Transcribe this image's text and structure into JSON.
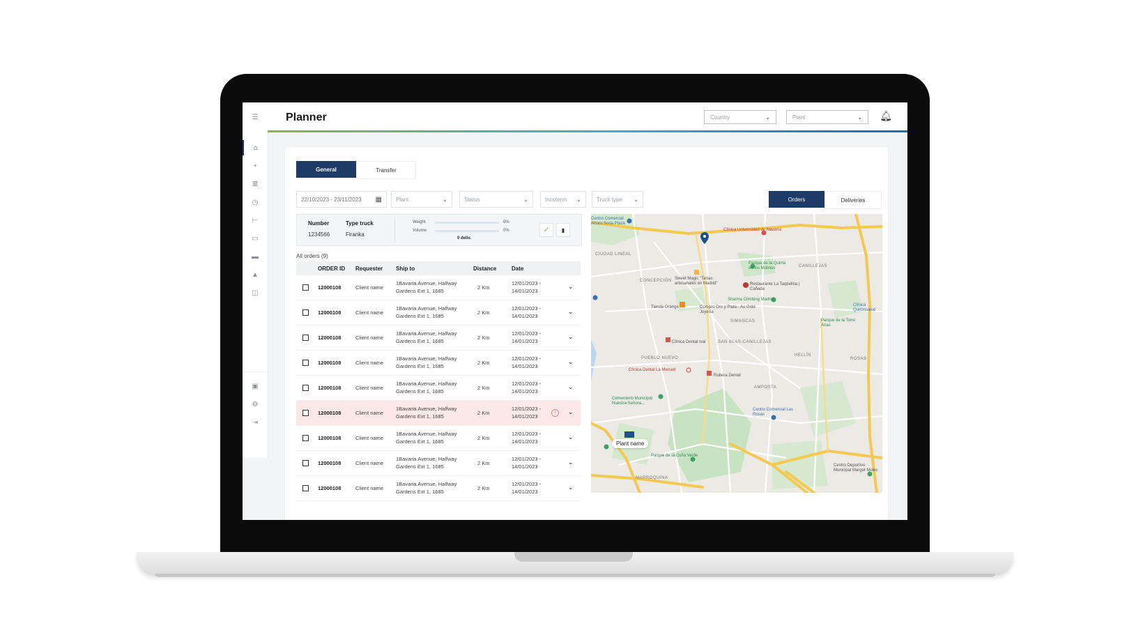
{
  "app": {
    "title": "Planner"
  },
  "header": {
    "country_placeholder": "Country",
    "plant_placeholder": "Plant"
  },
  "tabs": {
    "general": "General",
    "transfer": "Transfer"
  },
  "filters": {
    "date_range": "22/10/2023 - 23/11/2023",
    "plant": "Plant",
    "status": "Status",
    "incoterm": "Incoterm",
    "truck_type": "Truck type"
  },
  "view_toggle": {
    "orders": "Orders",
    "deliveries": "Deliveries"
  },
  "truck": {
    "number_label": "Number",
    "number_value": "1234566",
    "type_label": "Type truck",
    "type_value": "Firanka",
    "weight_label": "Weight",
    "weight_pct": "0%",
    "volume_label": "Volume",
    "volume_pct": "0%",
    "deliveries": "0 deliv."
  },
  "orders_title": "All orders (9)",
  "table": {
    "headers": {
      "order_id": "ORDER ID",
      "requester": "Requester",
      "ship_to": "Ship to",
      "distance": "Distance",
      "date": "Date"
    },
    "rows": [
      {
        "order_id": "12000108",
        "requester": "Client name",
        "ship_to": "1Bavaria Avenue, Halfway Gardens Ext 1, 1685",
        "distance": "2 Km",
        "date": "12/01/2023 - 14/01/2023",
        "alert": false
      },
      {
        "order_id": "12000108",
        "requester": "Client name",
        "ship_to": "1Bavaria Avenue, Halfway Gardens Ext 1, 1685",
        "distance": "2 Km",
        "date": "12/01/2023 - 14/01/2023",
        "alert": false
      },
      {
        "order_id": "12000108",
        "requester": "Client name",
        "ship_to": "1Bavaria Avenue, Halfway Gardens Ext 1, 1685",
        "distance": "2 Km",
        "date": "12/01/2023 - 14/01/2023",
        "alert": false
      },
      {
        "order_id": "12000108",
        "requester": "Client name",
        "ship_to": "1Bavaria Avenue, Halfway Gardens Ext 1, 1685",
        "distance": "2 Km",
        "date": "12/01/2023 - 14/01/2023",
        "alert": false
      },
      {
        "order_id": "12000108",
        "requester": "Client name",
        "ship_to": "1Bavaria Avenue, Halfway Gardens Ext 1, 1685",
        "distance": "2 Km",
        "date": "12/01/2023 - 14/01/2023",
        "alert": false
      },
      {
        "order_id": "12000108",
        "requester": "Client name",
        "ship_to": "1Bavaria Avenue, Halfway Gardens Ext 1, 1685",
        "distance": "2 Km",
        "date": "12/01/2023 - 14/01/2023",
        "alert": true
      },
      {
        "order_id": "12000108",
        "requester": "Client name",
        "ship_to": "1Bavaria Avenue, Halfway Gardens Ext 1, 1685",
        "distance": "2 Km",
        "date": "12/01/2023 - 14/01/2023",
        "alert": false
      },
      {
        "order_id": "12000108",
        "requester": "Client name",
        "ship_to": "1Bavaria Avenue, Halfway Gardens Ext 1, 1685",
        "distance": "2 Km",
        "date": "12/01/2023 - 14/01/2023",
        "alert": false
      },
      {
        "order_id": "12000108",
        "requester": "Client name",
        "ship_to": "1Bavaria Avenue, Halfway Gardens Ext 1, 1685",
        "distance": "2 Km",
        "date": "12/01/2023 - 14/01/2023",
        "alert": false
      }
    ]
  },
  "map": {
    "plant_label": "Plant name",
    "places": {
      "ciudad_lineal": "CIUDAD LINEAL",
      "concepcion": "CONCEPCIÓN",
      "canillejas": "CANILLEJAS",
      "simancas": "SIMANCAS",
      "san_blas": "SAN BLAS-CANILLEJAS",
      "pueblo_nuevo": "PUEBLO NUEVO",
      "hellin": "HELLÍN",
      "rosas": "ROSAS",
      "amposta": "AMPOSTA",
      "marroquina": "MARROQUINA",
      "sweet_magic": "Sweet Magic \"Tartas artesanales en Madrid\"",
      "restaurante": "Restaurante La Taqbelina | Cañada",
      "sharma": "Sharma Climbing Madrid",
      "tienda": "Tienda Orange",
      "compro_oro": "Compro Oro y Plata - Au Gold Joyería",
      "clinica_1": "Clínica Dental Ival",
      "clinica_2": "Clínica Dental La Merced",
      "rubera": "Rubera Dental",
      "cementerio": "Cementerio Municipal Nuestra Señora...",
      "centro_comercial": "Centro Comercial Las Rosas",
      "parque_ocho": "Parque de la Quinta de los Molinos",
      "parque_canto": "Parque de la Cuña Verde",
      "parque_torre": "Parque de la Torre Arias",
      "centro_deportivo": "Centro Deportivo Municipal Margot Moles",
      "clinica_uni": "Clínica Universidad de Navarra",
      "centro_arturo": "Centro Comercial Arturo Soria Plaza",
      "clinica_qu": "Clínica Quirónsalud"
    }
  },
  "colors": {
    "accent": "#1e3a66",
    "alert_row": "#fde8e8"
  }
}
